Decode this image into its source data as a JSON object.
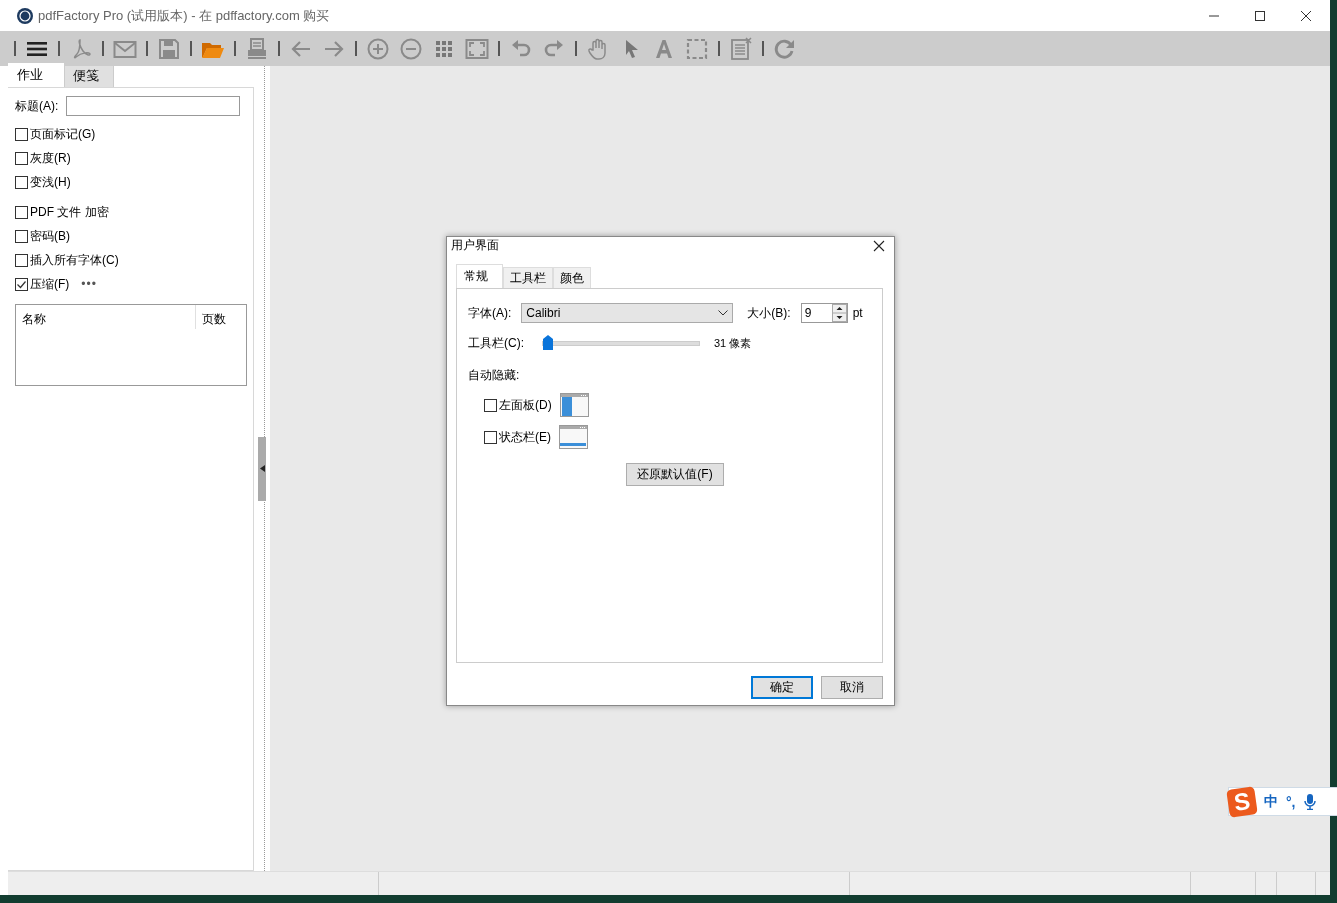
{
  "window": {
    "title": "pdfFactory Pro (试用版本) - 在 pdffactory.com 购买"
  },
  "toolbar": [
    {
      "kind": "separator"
    },
    {
      "kind": "menu"
    },
    {
      "kind": "separator"
    },
    {
      "kind": "pdf"
    },
    {
      "kind": "separator"
    },
    {
      "kind": "mail"
    },
    {
      "kind": "separator"
    },
    {
      "kind": "save"
    },
    {
      "kind": "separator"
    },
    {
      "kind": "folder"
    },
    {
      "kind": "separator"
    },
    {
      "kind": "printer"
    },
    {
      "kind": "separator"
    },
    {
      "kind": "arrow-left"
    },
    {
      "kind": "arrow-right"
    },
    {
      "kind": "separator"
    },
    {
      "kind": "zoom-in"
    },
    {
      "kind": "zoom-out"
    },
    {
      "kind": "grid"
    },
    {
      "kind": "fit-screen"
    },
    {
      "kind": "separator"
    },
    {
      "kind": "undo"
    },
    {
      "kind": "redo"
    },
    {
      "kind": "separator"
    },
    {
      "kind": "hand"
    },
    {
      "kind": "pointer"
    },
    {
      "kind": "text-tool"
    },
    {
      "kind": "selection"
    },
    {
      "kind": "separator"
    },
    {
      "kind": "notes"
    },
    {
      "kind": "separator"
    },
    {
      "kind": "refresh"
    }
  ],
  "sidebar": {
    "tabs": [
      {
        "label": "作业",
        "selected": true
      },
      {
        "label": "便笺",
        "selected": false
      }
    ],
    "title_field": {
      "label": "标题(A):"
    },
    "option_groups": [
      [
        {
          "label": "页面标记(G)",
          "checked": false
        },
        {
          "label": "灰度(R)",
          "checked": false
        },
        {
          "label": "变浅(H)",
          "checked": false
        }
      ],
      [
        {
          "label": "PDF 文件 加密",
          "checked": false
        },
        {
          "label": "密码(B)",
          "checked": false
        },
        {
          "label": "插入所有字体(C)",
          "checked": false
        },
        {
          "label": "压缩(F)",
          "checked": true,
          "more": "•••"
        }
      ]
    ],
    "list": {
      "columns": [
        "名称",
        "页数"
      ]
    }
  },
  "dialog": {
    "title": "用户界面",
    "tabs": [
      {
        "label": "常规",
        "selected": true
      },
      {
        "label": "工具栏",
        "selected": false
      },
      {
        "label": "颜色",
        "selected": false
      }
    ],
    "font": {
      "label": "字体(A):",
      "value": "Calibri"
    },
    "size": {
      "label": "大小(B):",
      "value": "9",
      "unit": "pt"
    },
    "toolbar_size": {
      "label": "工具栏(C):",
      "level": 0.0,
      "reading": "31 像素"
    },
    "autohide": {
      "label": "自动隐藏:",
      "options": [
        {
          "label": "左面板(D)",
          "checked": false,
          "kind": "left-panel"
        },
        {
          "label": "状态栏(E)",
          "checked": false,
          "kind": "status-bar"
        }
      ]
    },
    "reset_button": "还原默认值(F)",
    "buttons": [
      {
        "label": "确定",
        "default": true
      },
      {
        "label": "取消",
        "default": false
      }
    ]
  },
  "ime": {
    "logo": "S",
    "mode": "中",
    "punctuation": "°,"
  }
}
